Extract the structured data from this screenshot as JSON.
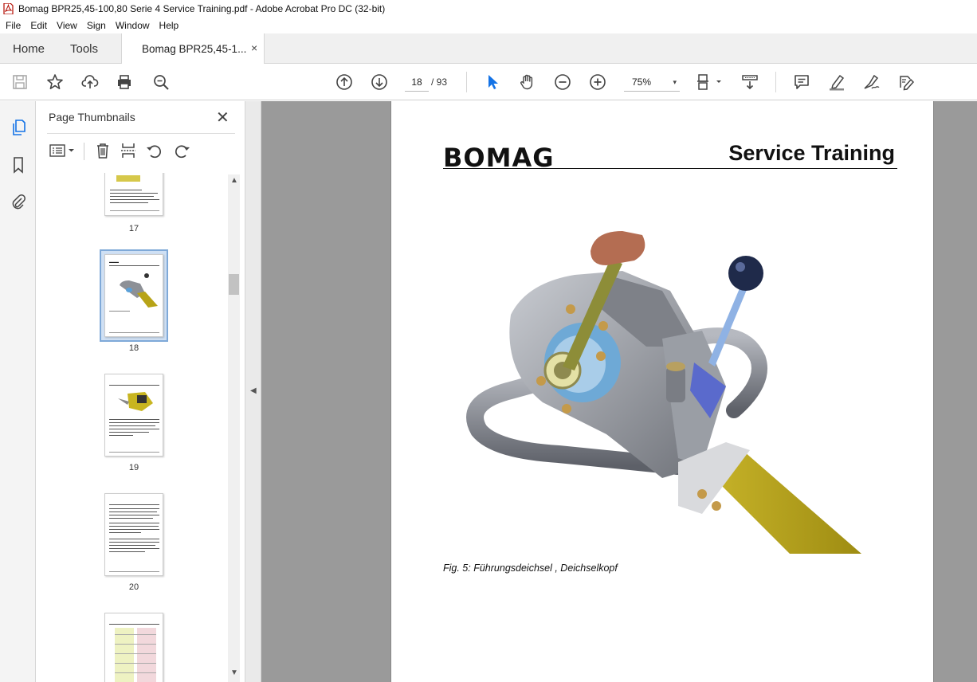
{
  "window": {
    "title": "Bomag BPR25,45-100,80 Serie 4 Service Training.pdf - Adobe Acrobat Pro DC (32-bit)"
  },
  "menu": [
    "File",
    "Edit",
    "View",
    "Sign",
    "Window",
    "Help"
  ],
  "tabs": {
    "home": "Home",
    "tools": "Tools",
    "document": "Bomag BPR25,45-1...",
    "close": "×"
  },
  "toolbar": {
    "current_page": "18",
    "page_count": "/ 93",
    "zoom": "75%",
    "zoom_caret": "▾",
    "icons": [
      "save-icon",
      "star-icon",
      "upload-icon",
      "print-icon",
      "zoom-search-icon",
      "page-up-icon",
      "page-down-icon",
      "select-cursor-icon",
      "hand-icon",
      "zoom-out-icon",
      "zoom-in-icon",
      "page-fit-icon",
      "scroll-mode-icon",
      "comment-icon",
      "highlight-icon",
      "sign-icon",
      "edit-pdf-icon"
    ]
  },
  "thumbnails_panel": {
    "title": "Page Thumbnails",
    "close": "✕",
    "pages": [
      {
        "num": "17"
      },
      {
        "num": "18",
        "selected": true
      },
      {
        "num": "19"
      },
      {
        "num": "20"
      }
    ]
  },
  "document": {
    "brand": "BOMAG",
    "header_title": "Service Training",
    "caption": "Fig. 5: Führungsdeichsel , Deichselkopf"
  },
  "colors": {
    "accent": "#1473e6",
    "doc_bg": "#9a9a9a",
    "yellow": "#b7a317"
  }
}
